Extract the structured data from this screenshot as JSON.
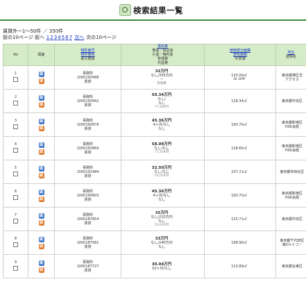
{
  "page": {
    "title": "検索結果一覧"
  },
  "summary": {
    "text": "賃貸外一1〜50件 ／ 350件"
  },
  "pager": {
    "prev10": "前の10ページ",
    "prev": "前へ",
    "pages": [
      "1",
      "2",
      "3",
      "4",
      "5",
      "6",
      "7"
    ],
    "next": "次へ",
    "next10": "次の10ページ"
  },
  "columns": {
    "no": "No",
    "fig": "図面",
    "col3": [
      "物件番号",
      "物件種目",
      "取引態様"
    ],
    "col4": [
      "賃料等",
      "敷金／保証金",
      "礼金／権利金",
      "管理費",
      "共益費"
    ],
    "col5": [
      "使用部分面積",
      "専有面積",
      "坪単価"
    ],
    "col6": [
      "所在",
      "建物名"
    ]
  },
  "figure_labels": {
    "top": "図",
    "bottom": "図"
  },
  "rows": [
    {
      "no": "1",
      "company": "事務所",
      "id": "1000193488",
      "kind": "賃貸",
      "price": "32万円",
      "deposit": "なし/330万円",
      "key": "ー",
      "fee": "管理費",
      "area": "120.00㎡",
      "tsubo": "36.30坪",
      "unit": "",
      "addr": "東京都港区芝",
      "bldg": "アクセス"
    },
    {
      "no": "2",
      "company": "事務所",
      "id": "1000193942",
      "kind": "賃貸",
      "price": "50.34万円",
      "deposit": "なし/",
      "key": "なし",
      "fee": "77,468円",
      "area": "118.34㎡",
      "tsubo": "",
      "unit": "",
      "addr": "東京都中央区",
      "bldg": ""
    },
    {
      "no": "3",
      "company": "事務所",
      "id": "1000192878",
      "kind": "賃貸",
      "price": "45.36万円",
      "deposit": "4ヶ月/なし",
      "key": "なし",
      "fee": "",
      "area": "100.70㎡",
      "tsubo": "",
      "unit": "",
      "addr": "東京都新宿区",
      "bldg": "HSK会館"
    },
    {
      "no": "4",
      "company": "事務所",
      "id": "1000191869",
      "kind": "賃貸",
      "price": "58.09万円",
      "deposit": "なし/なし",
      "key": "",
      "fee": "77,408円",
      "area": "118.65㎡",
      "tsubo": "",
      "unit": "",
      "addr": "東京都新宿区",
      "bldg": "HSK会館"
    },
    {
      "no": "5",
      "company": "事務所",
      "id": "1000191484",
      "kind": "賃貸",
      "price": "32.50万円",
      "deposit": "なし/なし",
      "key": "",
      "fee": "50,000円",
      "area": "107.21㎡",
      "tsubo": "",
      "unit": "",
      "addr": "東京都世田谷区",
      "bldg": ""
    },
    {
      "no": "6",
      "company": "事務所",
      "id": "1000190803",
      "kind": "賃貸",
      "price": "45.36万円",
      "deposit": "4ヶ月/なし",
      "key": "なし",
      "fee": "",
      "area": "100.70㎡",
      "tsubo": "",
      "unit": "",
      "addr": "東京都新宿区",
      "bldg": "HSK会館"
    },
    {
      "no": "7",
      "company": "事務所",
      "id": "1000187854",
      "kind": "賃貸",
      "price": "35万円",
      "deposit": "なし/210万円",
      "key": "なし",
      "fee": "50,000円",
      "area": "115.71㎡",
      "tsubo": "",
      "unit": "",
      "addr": "東京都中央区",
      "bldg": ""
    },
    {
      "no": "8",
      "company": "事務所",
      "id": "1000187581",
      "kind": "賃貸",
      "price": "33万円",
      "deposit": "なし/240万円",
      "key": "なし",
      "fee": "",
      "area": "108.90㎡",
      "tsubo": "",
      "unit": "",
      "addr": "東京都千代田区",
      "bldg": "第5セイコー"
    },
    {
      "no": "9",
      "company": "事務所",
      "id": "1000187727",
      "kind": "賃貸",
      "price": "30.04万円",
      "deposit": "10ヶ月/なし",
      "key": "",
      "fee": "",
      "area": "113.89㎡",
      "tsubo": "",
      "unit": "",
      "addr": "東京都台東区",
      "bldg": ""
    }
  ],
  "colors": {
    "header_bg": "#d6ecc8",
    "title_rule": "#3b8a3b",
    "link": "#1030c0",
    "fig_blue": "#3d74c8",
    "fig_orange": "#e0782a"
  }
}
